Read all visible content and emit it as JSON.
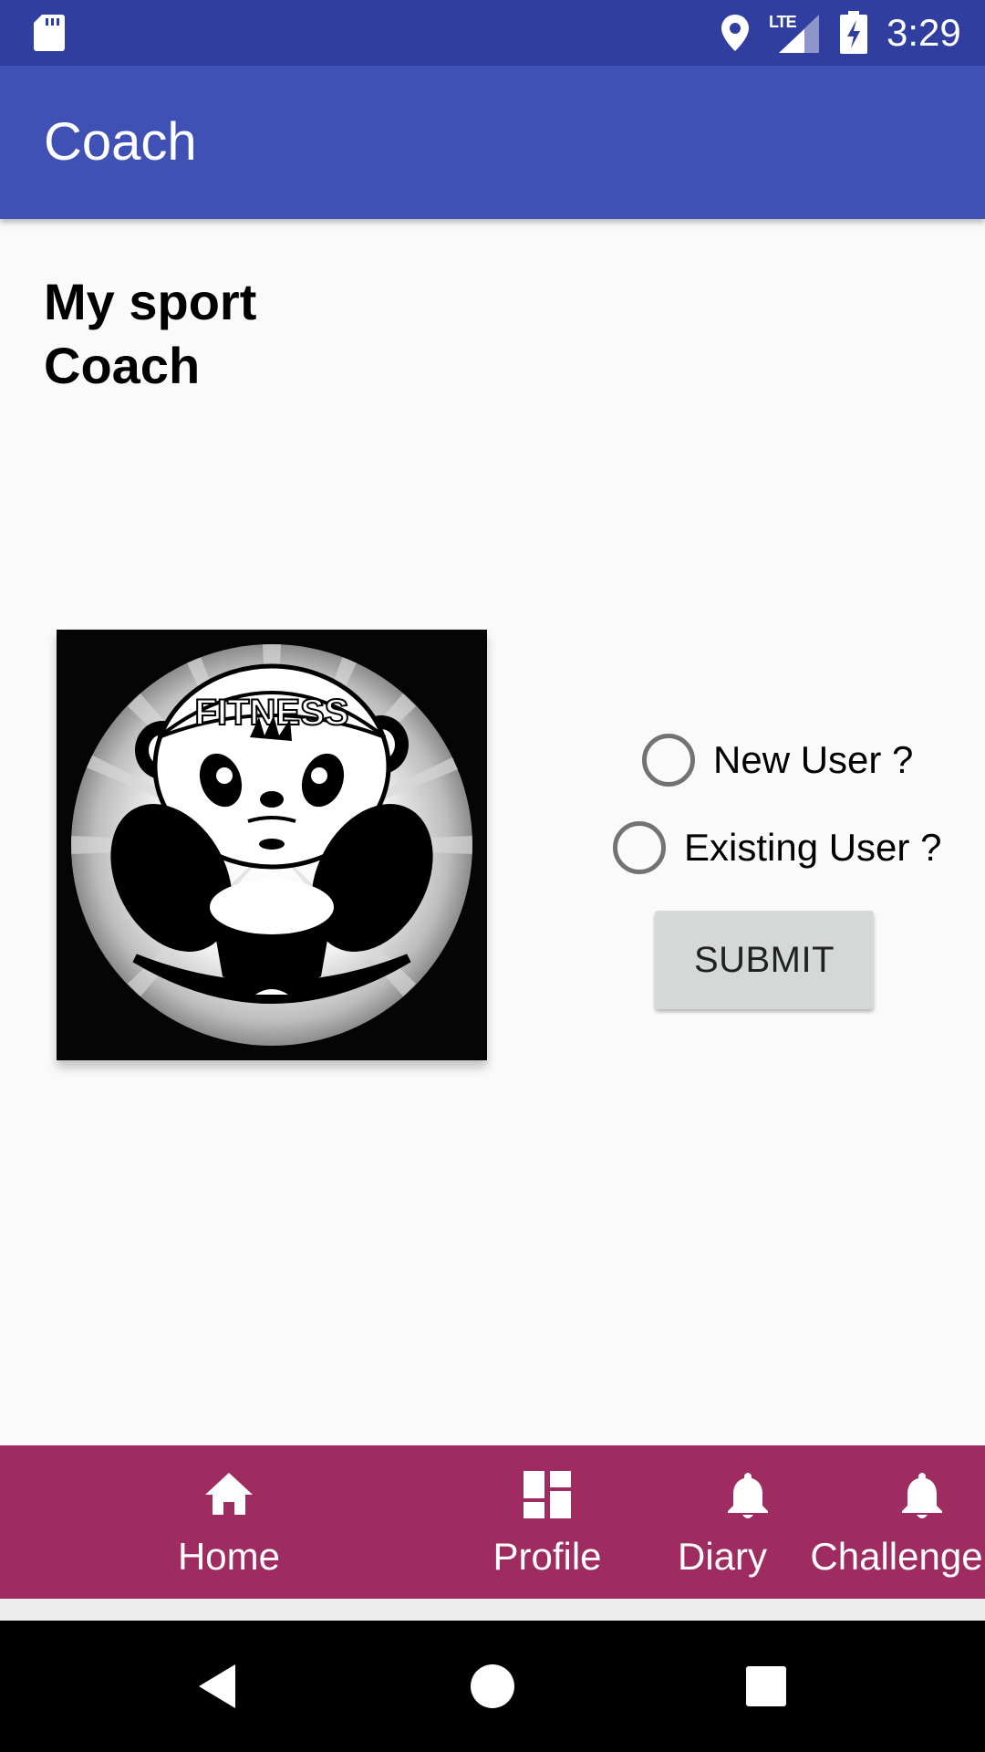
{
  "status_bar": {
    "time": "3:29",
    "network_label": "LTE",
    "icons": [
      "sd-card-icon",
      "location-icon",
      "lte-signal-icon",
      "battery-charging-icon"
    ]
  },
  "app_bar": {
    "title": "Coach",
    "color": "#3F51B5"
  },
  "main": {
    "heading_line1": "My sport",
    "heading_line2": "Coach",
    "logo": {
      "icon": "panda-fitness-logo",
      "banner_text": "FITNESS"
    },
    "radio_options": [
      {
        "label": "New User ?",
        "checked": false
      },
      {
        "label": "Existing User ?",
        "checked": false
      }
    ],
    "submit_label": "SUBMIT"
  },
  "bottom_nav": {
    "color": "#9E2C61",
    "items": [
      {
        "label": "Home",
        "icon": "home-icon"
      },
      {
        "label": "Profile",
        "icon": "dashboard-icon"
      },
      {
        "label": "Diary",
        "icon": "bell-icon"
      },
      {
        "label": "Challenge",
        "icon": "bell-icon"
      }
    ]
  },
  "system_nav": {
    "buttons": [
      "back-icon",
      "home-circle-icon",
      "recents-icon"
    ]
  }
}
